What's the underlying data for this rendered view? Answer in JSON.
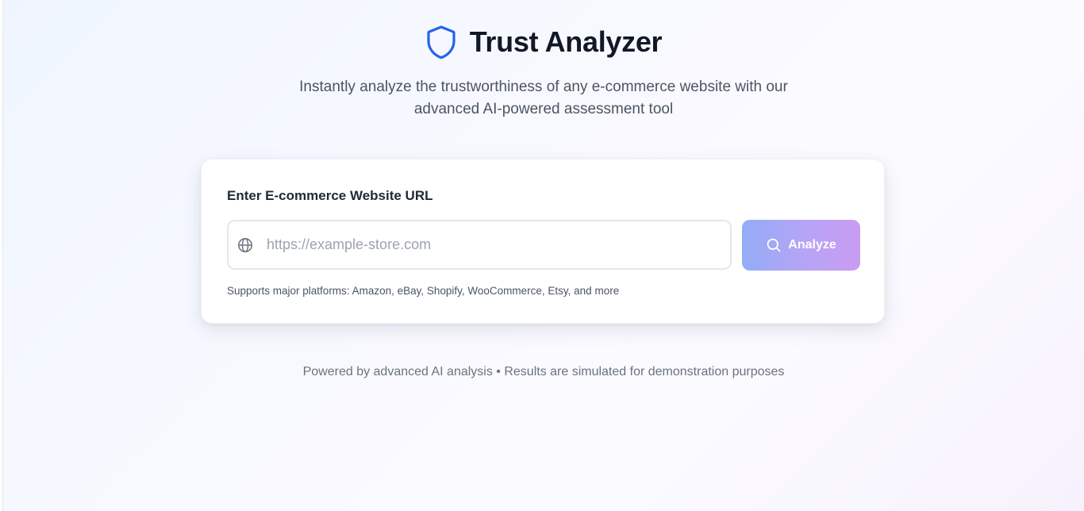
{
  "header": {
    "title": "Trust Analyzer",
    "logo_icon": "shield-icon",
    "accent_color": "#2563eb"
  },
  "subtitle": "Instantly analyze the trustworthiness of any e-commerce website with our advanced AI-powered assessment tool",
  "form": {
    "label": "Enter E-commerce Website URL",
    "input": {
      "value": "",
      "placeholder": "https://example-store.com",
      "icon": "globe-icon"
    },
    "button": {
      "label": "Analyze",
      "icon": "search-icon",
      "gradient": [
        "#93acf7",
        "#c99cf2"
      ]
    },
    "hint": "Supports major platforms: Amazon, eBay, Shopify, WooCommerce, Etsy, and more"
  },
  "footer": {
    "text": "Powered by advanced AI analysis • Results are simulated for demonstration purposes"
  }
}
